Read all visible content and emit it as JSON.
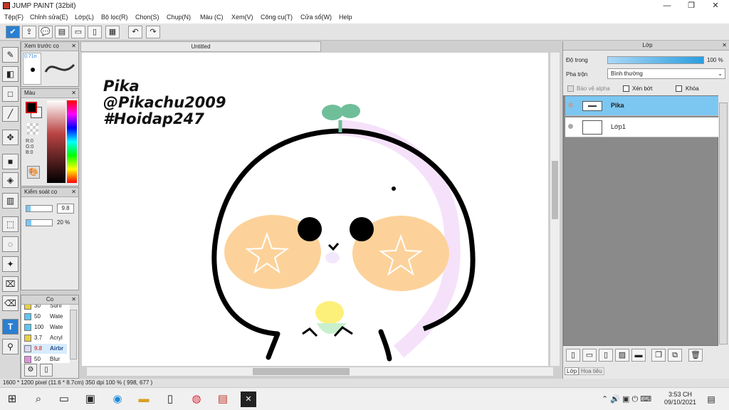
{
  "window": {
    "title": "JUMP PAINT (32bit)",
    "minimize": "—",
    "maximize": "❐",
    "close": "✕"
  },
  "menu": [
    "Tệp(F)",
    "Chỉnh sửa(E)",
    "Lớp(L)",
    "Bộ lọc(R)",
    "Chọn(S)",
    "Chụp(N)",
    "Màu (C)",
    "Xem(V)",
    "Công cụ(T)",
    "Cửa sổ(W)",
    "Help"
  ],
  "panels": {
    "preview": {
      "title": "Xem trước cọ",
      "size": "0.71n"
    },
    "color": {
      "title": "Màu",
      "r": "R:0",
      "g": "G:0",
      "b": "B:0",
      "fg": "#000000",
      "bg": "#ffffff"
    },
    "brush_control": {
      "title": "Kiểm soát cọ",
      "size": "9.8",
      "opacity": "20 %",
      "opacity_fraction": 0.2
    },
    "brush_list": {
      "title": "Co",
      "items": [
        {
          "value": "30",
          "name": "Surfi",
          "color": "#e8d040"
        },
        {
          "value": "50",
          "name": "Wate",
          "color": "#5bc8f0"
        },
        {
          "value": "100",
          "name": "Wate",
          "color": "#5bc8f0"
        },
        {
          "value": "3.7",
          "name": "Acryl",
          "color": "#e8d040"
        },
        {
          "value": "9.8",
          "name": "Airbr",
          "color": "#d8d8f8"
        },
        {
          "value": "50",
          "name": "Blur",
          "color": "#e090e0"
        }
      ]
    }
  },
  "document": {
    "tab": "Untitled"
  },
  "canvas_text": {
    "line1": "Pika",
    "line2": "@Pikachu2009",
    "line3": "#Hoidap247"
  },
  "layers_panel": {
    "title": "Lớp",
    "opacity_label": "Độ trong",
    "opacity_value": "100 %",
    "opacity_fraction": 1.0,
    "blend_label": "Pha trộn",
    "blend_value": "Bình thường",
    "protect_alpha": "Bảo vệ alpha",
    "clipping": "Xén bớt",
    "lock": "Khóa",
    "layers": [
      {
        "name": "Pika",
        "selected": true
      },
      {
        "name": "Lớp1",
        "selected": false
      }
    ],
    "tabs": [
      "Lớp",
      "Hoa tiêu"
    ]
  },
  "status": {
    "text": "1600 * 1200 pixel   (11.6 * 8.7cm)   350 dpi   100 %   ( 998, 677 )"
  },
  "taskbar": {
    "time": "3:53 CH",
    "date": "09/10/2021"
  },
  "colors": {
    "accent": "#2a7fd1",
    "layer_selected": "#7cc6f2"
  }
}
